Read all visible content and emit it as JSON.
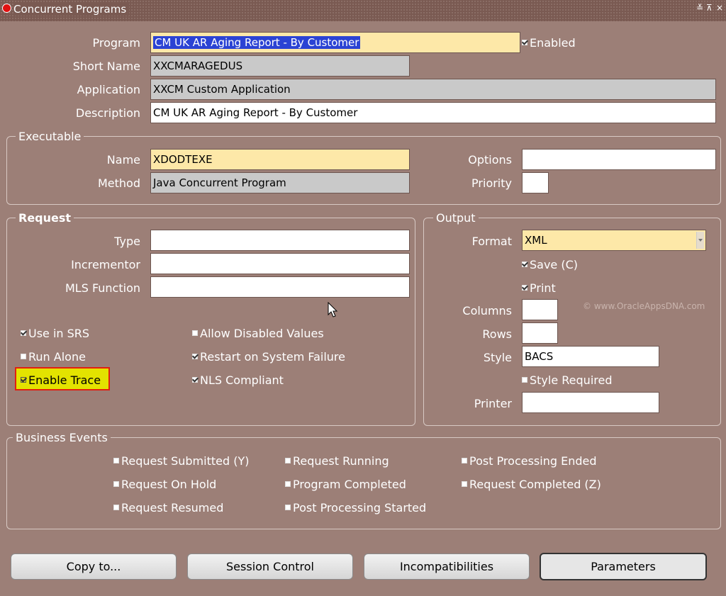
{
  "window": {
    "title": "Concurrent Programs",
    "controls": [
      "≚",
      "⊼",
      "×"
    ]
  },
  "main": {
    "program": {
      "label": "Program",
      "value": "CM UK AR Aging Report - By Customer"
    },
    "enabled": {
      "label": "Enabled",
      "checked": true
    },
    "short_name": {
      "label": "Short Name",
      "value": "XXCMARAGEDUS"
    },
    "application": {
      "label": "Application",
      "value": "XXCM Custom Application"
    },
    "description": {
      "label": "Description",
      "value": "CM UK AR Aging Report - By Customer"
    }
  },
  "executable": {
    "group_title": "Executable",
    "name": {
      "label": "Name",
      "value": "XDODTEXE"
    },
    "method": {
      "label": "Method",
      "value": "Java Concurrent Program"
    },
    "options": {
      "label": "Options",
      "value": ""
    },
    "priority": {
      "label": "Priority",
      "value": ""
    }
  },
  "request": {
    "group_title": "Request",
    "type": {
      "label": "Type",
      "value": ""
    },
    "incrementor": {
      "label": "Incrementor",
      "value": ""
    },
    "mls_function": {
      "label": "MLS Function",
      "value": ""
    },
    "checkboxes": {
      "use_in_srs": {
        "label": "Use in SRS",
        "checked": true
      },
      "run_alone": {
        "label": "Run Alone",
        "checked": false
      },
      "enable_trace": {
        "label": "Enable Trace",
        "checked": true
      },
      "allow_disabled_values": {
        "label": "Allow Disabled Values",
        "checked": false
      },
      "restart_on_system_failure": {
        "label": "Restart on System Failure",
        "checked": true
      },
      "nls_compliant": {
        "label": "NLS Compliant",
        "checked": true
      }
    }
  },
  "output": {
    "group_title": "Output",
    "format": {
      "label": "Format",
      "value": "XML"
    },
    "save": {
      "label": "Save (C)",
      "checked": true
    },
    "print": {
      "label": "Print",
      "checked": true
    },
    "columns": {
      "label": "Columns",
      "value": ""
    },
    "rows": {
      "label": "Rows",
      "value": ""
    },
    "style": {
      "label": "Style",
      "value": "BACS"
    },
    "style_required": {
      "label": "Style Required",
      "checked": false
    },
    "printer": {
      "label": "Printer",
      "value": ""
    }
  },
  "watermark": "© www.OracleAppsDNA.com",
  "business_events": {
    "group_title": "Business Events",
    "request_submitted": "Request Submitted (Y)",
    "request_on_hold": "Request On Hold",
    "request_resumed": "Request Resumed",
    "request_running": "Request Running",
    "program_completed": "Program Completed",
    "post_processing_started": "Post Processing Started",
    "post_processing_ended": "Post Processing Ended",
    "request_completed": "Request Completed (Z)"
  },
  "buttons": {
    "copy_to": "Copy to...",
    "session_control": "Session Control",
    "incompatibilities": "Incompatibilities",
    "parameters": "Parameters"
  }
}
